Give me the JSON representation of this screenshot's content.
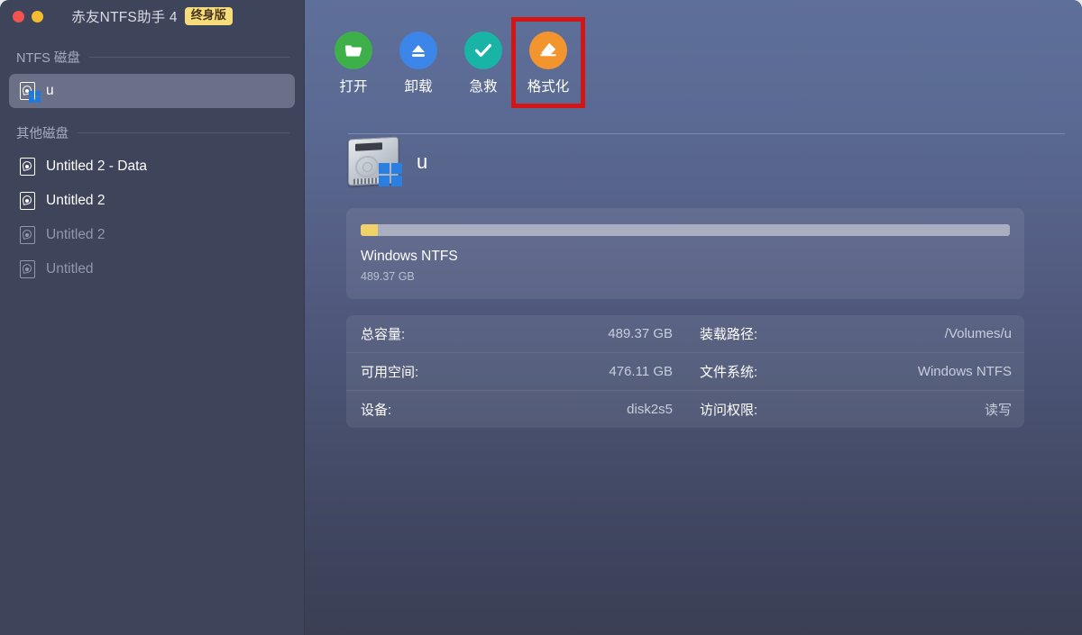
{
  "window": {
    "title": "赤友NTFS助手 4",
    "badge": "终身版",
    "traffic_lights": [
      "close",
      "minimize"
    ]
  },
  "sidebar": {
    "sections": [
      {
        "header": "NTFS 磁盘",
        "items": [
          {
            "label": "u",
            "selected": true,
            "dimmed": false,
            "windows": true
          }
        ]
      },
      {
        "header": "其他磁盘",
        "items": [
          {
            "label": "Untitled 2 - Data",
            "selected": false,
            "dimmed": false,
            "windows": false
          },
          {
            "label": "Untitled 2",
            "selected": false,
            "dimmed": false,
            "windows": false
          },
          {
            "label": "Untitled 2",
            "selected": false,
            "dimmed": true,
            "windows": false
          },
          {
            "label": "Untitled",
            "selected": false,
            "dimmed": true,
            "windows": false
          }
        ]
      }
    ]
  },
  "toolbar": {
    "buttons": [
      {
        "label": "打开",
        "icon": "folder-open-icon",
        "color": "#3db04a",
        "highlighted": false
      },
      {
        "label": "卸载",
        "icon": "eject-icon",
        "color": "#3b86e8",
        "highlighted": false
      },
      {
        "label": "急救",
        "icon": "check-icon",
        "color": "#18b4a6",
        "highlighted": false
      },
      {
        "label": "格式化",
        "icon": "eraser-icon",
        "color": "#f2952f",
        "highlighted": true
      }
    ],
    "highlight_color": "#d41515"
  },
  "volume": {
    "name": "u",
    "icon": "hard-drive-windows-icon",
    "capacity": {
      "filesystem": "Windows NTFS",
      "total_label": "489.37 GB",
      "used_percent": 2.7,
      "bar_used_color": "#f0d368",
      "bar_track_color": "#a9afc1"
    },
    "info_rows": [
      {
        "left_key": "总容量:",
        "left_value": "489.37 GB",
        "right_key": "装载路径:",
        "right_value": "/Volumes/u"
      },
      {
        "left_key": "可用空间:",
        "left_value": "476.11 GB",
        "right_key": "文件系统:",
        "right_value": "Windows NTFS"
      },
      {
        "left_key": "设备:",
        "left_value": "disk2s5",
        "right_key": "访问权限:",
        "right_value": "读写"
      }
    ]
  }
}
